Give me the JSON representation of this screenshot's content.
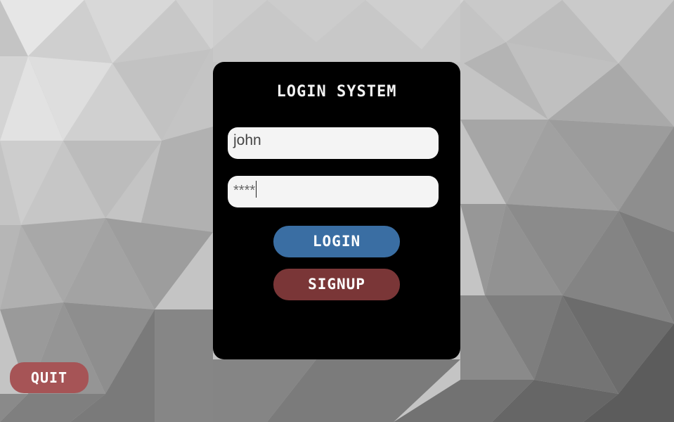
{
  "background": {
    "style": "low-poly gray triangles",
    "colors": [
      "#d9d9d9",
      "#bdbdbd",
      "#9e9e9e",
      "#7a7a7a",
      "#5e5e5e"
    ]
  },
  "panel": {
    "title": "LOGIN SYSTEM",
    "username_value": "john",
    "password_value": "****",
    "login_label": "LOGIN",
    "signup_label": "SIGNUP"
  },
  "quit_label": "QUIT",
  "colors": {
    "panel": "#000000",
    "login": "#3a6ea3",
    "signup": "#7a3637",
    "quit": "#a65456"
  }
}
